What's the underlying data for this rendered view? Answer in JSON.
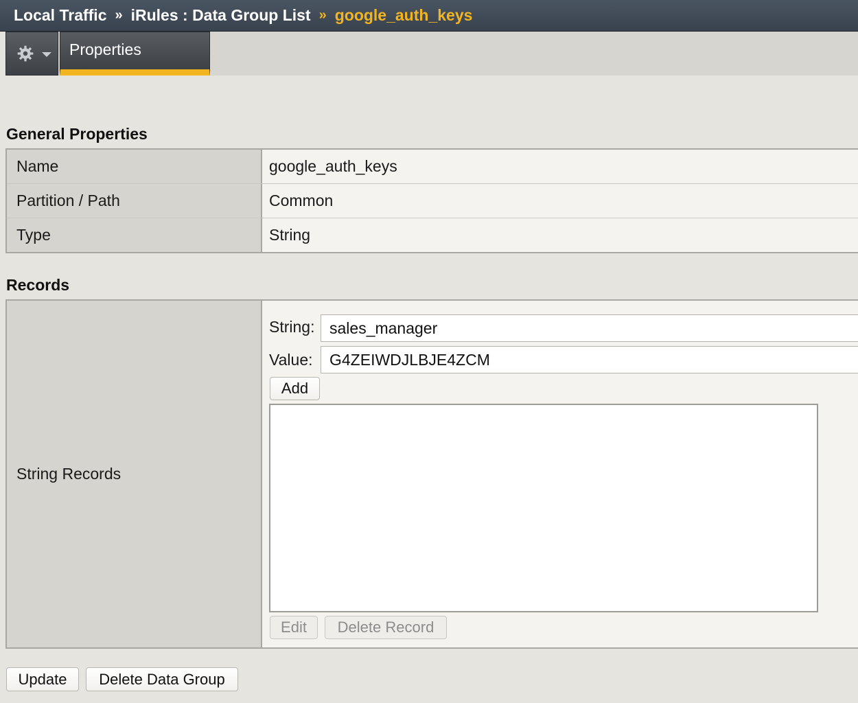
{
  "breadcrumb": {
    "items": [
      "Local Traffic",
      "iRules : Data Group List"
    ],
    "current": "google_auth_keys",
    "separator": "»"
  },
  "tabs": {
    "properties_label": "Properties"
  },
  "general_properties": {
    "title": "General Properties",
    "rows": [
      {
        "label": "Name",
        "value": "google_auth_keys"
      },
      {
        "label": "Partition / Path",
        "value": "Common"
      },
      {
        "label": "Type",
        "value": "String"
      }
    ]
  },
  "records": {
    "title": "Records",
    "row_label": "String Records",
    "string_label": "String:",
    "string_value": "sales_manager",
    "value_label": "Value:",
    "value_value": "G4ZEIWDJLBJE4ZCM",
    "add_label": "Add",
    "edit_label": "Edit",
    "delete_record_label": "Delete Record"
  },
  "actions": {
    "update_label": "Update",
    "delete_group_label": "Delete Data Group"
  },
  "colors": {
    "accent": "#f3b51f",
    "header_bg": "#3d4752"
  }
}
